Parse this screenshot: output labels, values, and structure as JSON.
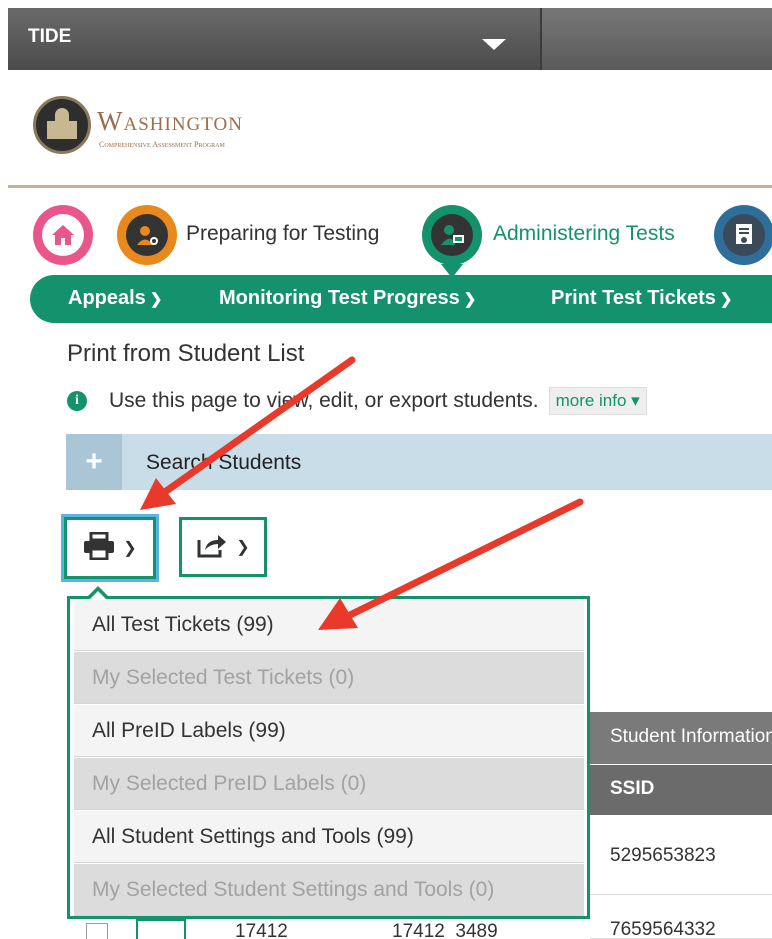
{
  "topbar": {
    "app_name": "TIDE"
  },
  "logo": {
    "title": "Washington",
    "subtitle": "Comprehensive Assessment Program"
  },
  "steps": {
    "preparing_label": "Preparing for Testing",
    "administering_label": "Administering Tests"
  },
  "nav": {
    "items": [
      {
        "label": "Appeals"
      },
      {
        "label": "Monitoring Test Progress"
      },
      {
        "label": "Print Test Tickets"
      }
    ],
    "chevron": "⌄"
  },
  "page": {
    "title": "Print from Student List",
    "info_text": "Use this page to view, edit, or export students.",
    "more_info_label": "more info ▾"
  },
  "search": {
    "label": "Search Students",
    "expand_symbol": "+"
  },
  "toolbar": {
    "print_chevron": "⌄",
    "export_chevron": "⌄"
  },
  "print_menu": {
    "items": [
      {
        "label": "All Test Tickets (99)",
        "enabled": true
      },
      {
        "label": "My Selected Test Tickets (0)",
        "enabled": false
      },
      {
        "label": "All PreID Labels (99)",
        "enabled": true
      },
      {
        "label": "My Selected PreID Labels (0)",
        "enabled": false
      },
      {
        "label": "All Student Settings and Tools (99)",
        "enabled": true
      },
      {
        "label": "My Selected Student Settings and Tools (0)",
        "enabled": false
      }
    ]
  },
  "table": {
    "group_header": "Student Information",
    "column_header": "SSID",
    "rows": [
      {
        "ssid": "5295653823"
      },
      {
        "col1": "17412",
        "col2": "17412_3489",
        "ssid": "7659564332"
      }
    ]
  },
  "colors": {
    "accent_green": "#13926b",
    "topbar_gray": "#5a5a5a",
    "annotation_red": "#e8392b",
    "search_blue": "#c9dde8"
  }
}
